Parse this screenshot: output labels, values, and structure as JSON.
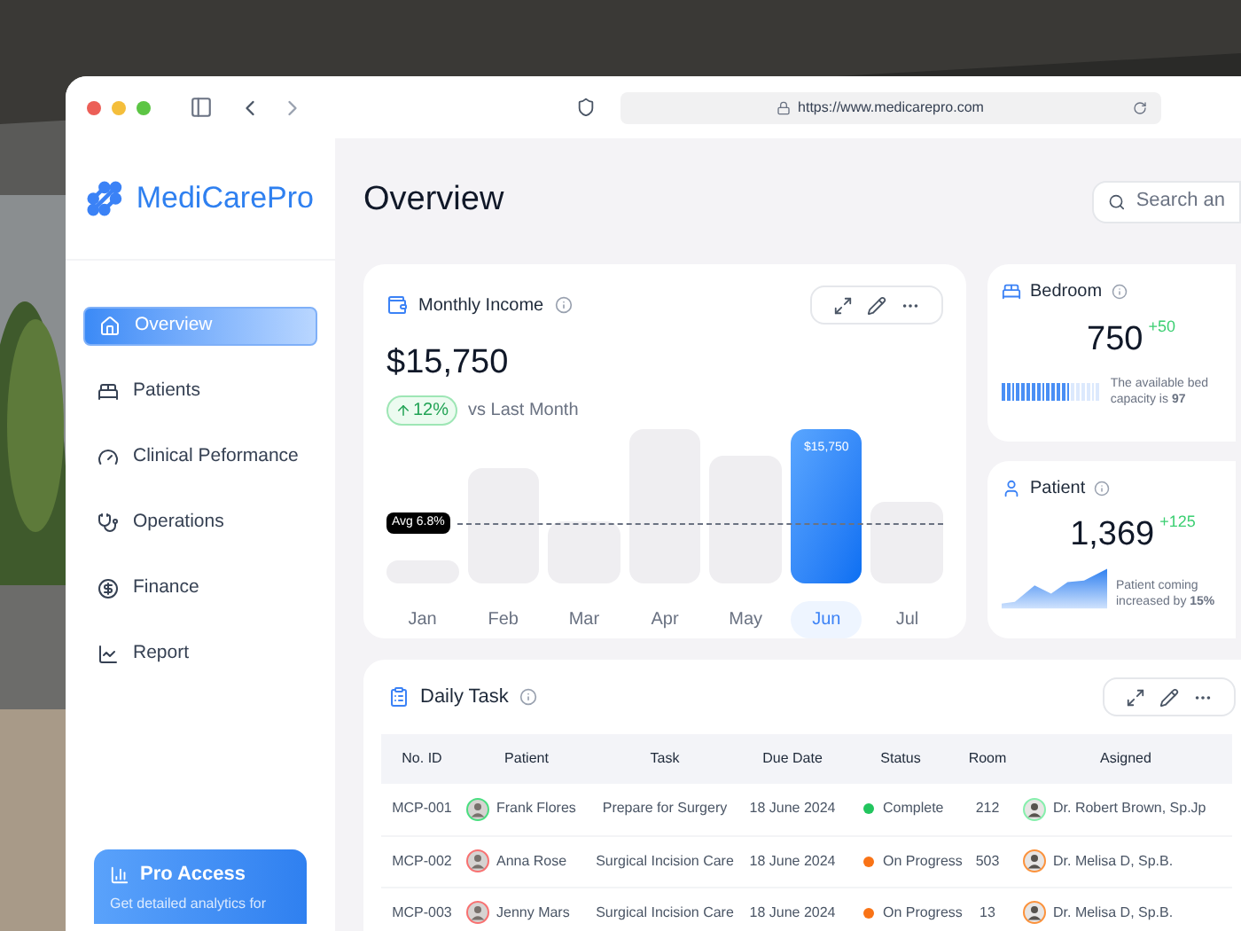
{
  "browser": {
    "url": "https://www.medicarepro.com"
  },
  "sidebar": {
    "logo": "MediCarePro",
    "items": [
      {
        "label": "Overview",
        "kind": "home",
        "selected": true
      },
      {
        "label": "Patients",
        "kind": "bed",
        "selected": false
      },
      {
        "label": "Clinical Peformance",
        "kind": "gauge",
        "selected": false
      },
      {
        "label": "Operations",
        "kind": "stethoscope",
        "selected": false
      },
      {
        "label": "Finance",
        "kind": "coin",
        "selected": false
      },
      {
        "label": "Report",
        "kind": "chart",
        "selected": false
      }
    ],
    "promo": {
      "title": "Pro Access",
      "text": "Get detailed analytics for"
    }
  },
  "header": {
    "title": "Overview",
    "search": {
      "placeholder": "Search an"
    }
  },
  "income": {
    "title": "Monthly Income",
    "amount": "$15,750",
    "change": "12%",
    "comparison": "vs Last Month",
    "average": "Avg 6.8%",
    "months": [
      {
        "label": "Jan",
        "level": 0.15,
        "selected": false
      },
      {
        "label": "Feb",
        "level": 0.74,
        "selected": false
      },
      {
        "label": "Mar",
        "level": 0.4,
        "selected": false
      },
      {
        "label": "Apr",
        "level": 1.0,
        "selected": false
      },
      {
        "label": "May",
        "level": 0.82,
        "selected": false
      },
      {
        "label": "Jun",
        "level": 1.0,
        "selected": true,
        "value": "$15,750"
      },
      {
        "label": "Jul",
        "level": 0.53,
        "selected": false
      }
    ]
  },
  "bedroom": {
    "title": "Bedroom",
    "count": "750",
    "delta": "+50",
    "level": 0.7,
    "note": "The available bed capacity is **97**"
  },
  "patient": {
    "title": "Patient",
    "count": "1,369",
    "delta": "+125",
    "note": "Patient coming increased by **15%**"
  },
  "tasks": {
    "title": "Daily Task",
    "columns": [
      "No. ID",
      "Patient",
      "Task",
      "Due Date",
      "Status",
      "Room",
      "Asigned"
    ],
    "rows": [
      {
        "id": "MCP-001",
        "patient": "Frank Flores",
        "task": "Prepare for Surgery",
        "due": "18 June 2024",
        "status": "Complete",
        "color": "#22c55e",
        "room": "212",
        "assigned": "Dr. Robert Brown, Sp.Jp"
      },
      {
        "id": "MCP-002",
        "patient": "Anna Rose",
        "task": "Surgical Incision Care",
        "due": "18 June 2024",
        "status": "On Progress",
        "color": "#f97316",
        "room": "503",
        "assigned": "Dr. Melisa D, Sp.B."
      },
      {
        "id": "MCP-003",
        "patient": "Jenny Mars",
        "task": "Surgical Incision Care",
        "due": "18 June 2024",
        "status": "On Progress",
        "color": "#f97316",
        "room": "13",
        "assigned": "Dr. Melisa D, Sp.B."
      }
    ]
  }
}
